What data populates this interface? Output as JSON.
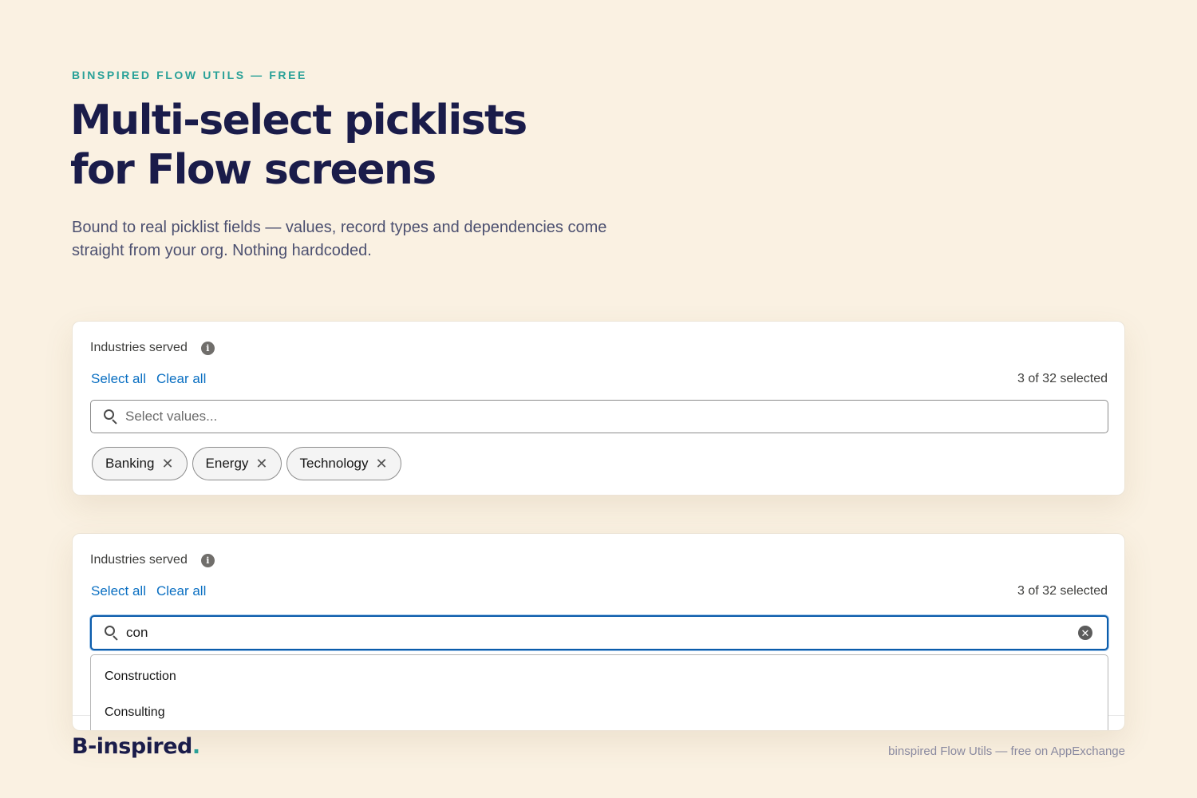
{
  "header": {
    "eyebrow": "BINSPIRED FLOW UTILS — FREE",
    "headline_line1": "Multi-select picklists",
    "headline_line2": "for Flow screens",
    "subhead_line1": "Bound to real picklist fields — values, record types and dependencies come",
    "subhead_line2": "straight from your org. Nothing hardcoded."
  },
  "card1": {
    "label": "Industries served",
    "info_icon": "info-icon",
    "select_all": "Select all",
    "clear_all": "Clear all",
    "count": "3 of 32 selected",
    "search_placeholder": "Select values...",
    "search_value": "",
    "pills": [
      {
        "label": "Banking",
        "remove_icon": "close-icon"
      },
      {
        "label": "Energy",
        "remove_icon": "close-icon"
      },
      {
        "label": "Technology",
        "remove_icon": "close-icon"
      }
    ]
  },
  "card2": {
    "label": "Industries served",
    "info_icon": "info-icon",
    "select_all": "Select all",
    "clear_all": "Clear all",
    "count": "3 of 32 selected",
    "search_value": "con",
    "options": [
      "Construction",
      "Consulting"
    ]
  },
  "footer": {
    "logo_text": "B-inspired",
    "logo_dot": ".",
    "tagline": "binspired Flow Utils — free on AppExchange"
  },
  "colors": {
    "background": "#faf1e2",
    "navy": "#1a1c4a",
    "teal": "#2aa198",
    "link_blue": "#0a6fc2",
    "focus_blue": "#0b5cab"
  }
}
